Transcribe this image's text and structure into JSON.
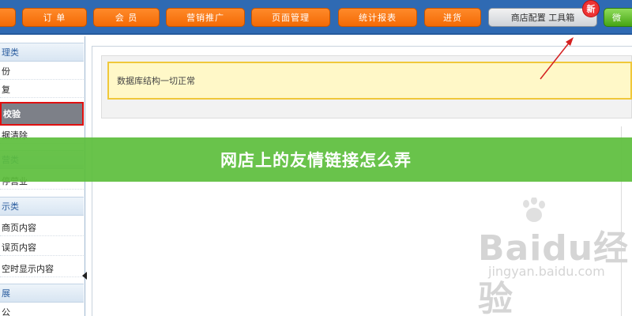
{
  "nav": {
    "items": [
      {
        "label": "订 单"
      },
      {
        "label": "会 员"
      },
      {
        "label": "营销推广"
      },
      {
        "label": "页面管理"
      },
      {
        "label": "统计报表"
      },
      {
        "label": "进货"
      },
      {
        "label": "商店配置  工具箱"
      },
      {
        "label": "微"
      }
    ],
    "new_badge": "新"
  },
  "sidebar": {
    "items": [
      {
        "label": "理类",
        "kind": "section"
      },
      {
        "label": "份",
        "kind": "item"
      },
      {
        "label": "复",
        "kind": "item"
      },
      {
        "label": "校验",
        "kind": "item",
        "selected": true
      },
      {
        "label": "据清除",
        "kind": "item"
      },
      {
        "label": "营类",
        "kind": "section"
      },
      {
        "label": "停营业",
        "kind": "item"
      },
      {
        "label": "示类",
        "kind": "section"
      },
      {
        "label": "商页内容",
        "kind": "item"
      },
      {
        "label": "误页内容",
        "kind": "item"
      },
      {
        "label": "空时显示内容",
        "kind": "item"
      },
      {
        "label": "展",
        "kind": "section"
      },
      {
        "label": "公",
        "kind": "item"
      }
    ]
  },
  "main": {
    "notice": "数据库结构一切正常"
  },
  "banner": {
    "title": "网店上的友情链接怎么弄"
  },
  "watermark": {
    "logo": "Baidu经验",
    "url": "jingyan.baidu.com"
  },
  "colors": {
    "nav_bg": "#2f6ab3",
    "nav_button": "#f36a05",
    "banner": "#5cbe3c",
    "notice_bg": "#fff8c8",
    "notice_border": "#f0c83a",
    "highlight_red": "#e01010"
  }
}
